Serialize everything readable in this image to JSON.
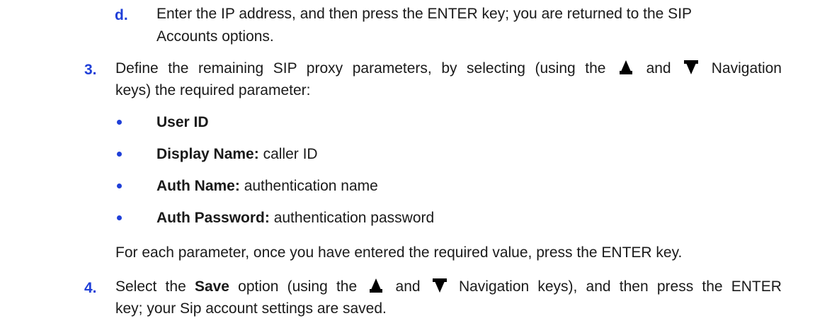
{
  "step_d": {
    "label": "d.",
    "line1": "Enter the IP address, and then press the ENTER key; you are returned to the SIP",
    "line2": "Accounts options."
  },
  "step_3": {
    "label": "3.",
    "line1_a": "Define the remaining SIP proxy parameters, by selecting (using the",
    "line1_and": "and",
    "line1_b": "Navigation",
    "line2": "keys) the required parameter:",
    "params": [
      {
        "name": "User ID",
        "desc": ""
      },
      {
        "name": "Display Name:",
        "desc": "caller ID"
      },
      {
        "name": "Auth Name:",
        "desc": "authentication name"
      },
      {
        "name": "Auth Password:",
        "desc": "authentication password"
      }
    ],
    "note": "For each parameter, once you have entered the required value, press the ENTER key."
  },
  "step_4": {
    "label": "4.",
    "line1_a": "Select the",
    "line1_save": "Save",
    "line1_b": "option (using the",
    "line1_and": "and",
    "line1_c": "Navigation keys), and then press the ENTER",
    "line2": "key; your Sip account settings are saved."
  },
  "icons": {
    "up": "navigation-up-arrow-icon",
    "down": "navigation-down-arrow-icon"
  },
  "colors": {
    "step_number": "#1f3fd8",
    "bullet": "#1f3fd8",
    "text": "#1a1a1a"
  }
}
